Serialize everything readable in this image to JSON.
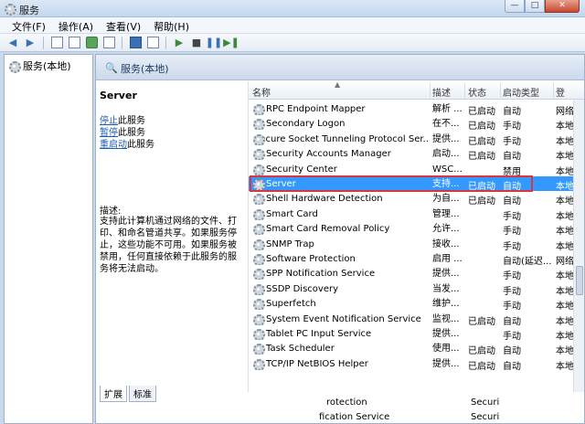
{
  "window": {
    "title": "服务"
  },
  "menu": [
    "文件(F)",
    "操作(A)",
    "查看(V)",
    "帮助(H)"
  ],
  "tree": {
    "root": "服务(本地)"
  },
  "panel": {
    "title": "服务(本地)"
  },
  "detail": {
    "service_name": "Server",
    "actions": [
      {
        "link": "停止",
        "text": "此服务"
      },
      {
        "link": "暂停",
        "text": "此服务"
      },
      {
        "link": "重启动",
        "text": "此服务"
      }
    ],
    "desc_label": "描述:",
    "description": "支持此计算机通过网络的文件、打印、和命名管道共享。如果服务停止，这些功能不可用。如果服务被禁用，任何直接依赖于此服务的服务将无法启动。"
  },
  "columns": {
    "name": "名称",
    "desc": "描述",
    "status": "状态",
    "startup": "启动类型",
    "logon": "登"
  },
  "rows": [
    {
      "name": "RPC Endpoint Mapper",
      "desc": "解析 ...",
      "status": "已启动",
      "startup": "自动",
      "logon": "网络"
    },
    {
      "name": "Secondary Logon",
      "desc": "在不...",
      "status": "已启动",
      "startup": "手动",
      "logon": "本地"
    },
    {
      "name": "Secure Socket Tunneling Protocol Ser...",
      "desc": "提供...",
      "status": "已启动",
      "startup": "手动",
      "logon": "本地"
    },
    {
      "name": "Security Accounts Manager",
      "desc": "启动...",
      "status": "已启动",
      "startup": "自动",
      "logon": "本地"
    },
    {
      "name": "Security Center",
      "desc": "WSC...",
      "status": "",
      "startup": "禁用",
      "logon": "本地"
    },
    {
      "name": "Server",
      "desc": "支持...",
      "status": "已启动",
      "startup": "自动",
      "logon": "本地"
    },
    {
      "name": "Shell Hardware Detection",
      "desc": "为自...",
      "status": "已启动",
      "startup": "自动",
      "logon": "本地"
    },
    {
      "name": "Smart Card",
      "desc": "管理...",
      "status": "",
      "startup": "手动",
      "logon": "本地"
    },
    {
      "name": "Smart Card Removal Policy",
      "desc": "允许...",
      "status": "",
      "startup": "手动",
      "logon": "本地"
    },
    {
      "name": "SNMP Trap",
      "desc": "接收...",
      "status": "",
      "startup": "手动",
      "logon": "本地"
    },
    {
      "name": "Software Protection",
      "desc": "启用 ...",
      "status": "",
      "startup": "自动(延迟...",
      "logon": "网络"
    },
    {
      "name": "SPP Notification Service",
      "desc": "提供...",
      "status": "",
      "startup": "手动",
      "logon": "本地"
    },
    {
      "name": "SSDP Discovery",
      "desc": "当发...",
      "status": "",
      "startup": "手动",
      "logon": "本地"
    },
    {
      "name": "Superfetch",
      "desc": "维护...",
      "status": "",
      "startup": "手动",
      "logon": "本地"
    },
    {
      "name": "System Event Notification Service",
      "desc": "监视...",
      "status": "已启动",
      "startup": "自动",
      "logon": "本地"
    },
    {
      "name": "Tablet PC Input Service",
      "desc": "提供...",
      "status": "",
      "startup": "手动",
      "logon": "本地"
    },
    {
      "name": "Task Scheduler",
      "desc": "使用...",
      "status": "已启动",
      "startup": "自动",
      "logon": "本地"
    },
    {
      "name": "TCP/IP NetBIOS Helper",
      "desc": "提供...",
      "status": "已启动",
      "startup": "自动",
      "logon": "本地"
    }
  ],
  "bottom": [
    {
      "name": "rotection",
      "startup": "Securi"
    },
    {
      "name": "fication Service",
      "startup": "Securi"
    }
  ],
  "tabs": [
    "扩展",
    "标准"
  ],
  "selected_index": 5
}
